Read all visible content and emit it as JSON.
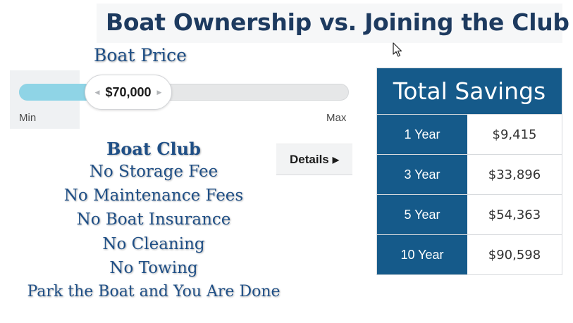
{
  "header": {
    "title": "Boat Ownership vs. Joining the Club"
  },
  "price": {
    "label": "Boat Price",
    "value_display": "$70,000",
    "min_label": "Min",
    "max_label": "Max",
    "slider_fraction": 0.2,
    "thumb_left_arrow": "◀",
    "thumb_right_arrow": "▶"
  },
  "club": {
    "heading": "Boat Club",
    "items": [
      "No Storage Fee",
      "No Maintenance Fees",
      "No Boat Insurance",
      "No Cleaning",
      "No Towing",
      "Park the Boat and You Are Done"
    ]
  },
  "details": {
    "label": "Details",
    "arrow": "▶"
  },
  "savings": {
    "title": "Total Savings",
    "rows": [
      {
        "period": "1 Year",
        "amount": "$9,415"
      },
      {
        "period": "3 Year",
        "amount": "$33,896"
      },
      {
        "period": "5 Year",
        "amount": "$54,363"
      },
      {
        "period": "10 Year",
        "amount": "$90,598"
      }
    ]
  },
  "colors": {
    "accent": "#155a8a",
    "title": "#1d3a5f",
    "slider_fill": "#8fd4e6",
    "benefit_text": "#1f4f86"
  }
}
